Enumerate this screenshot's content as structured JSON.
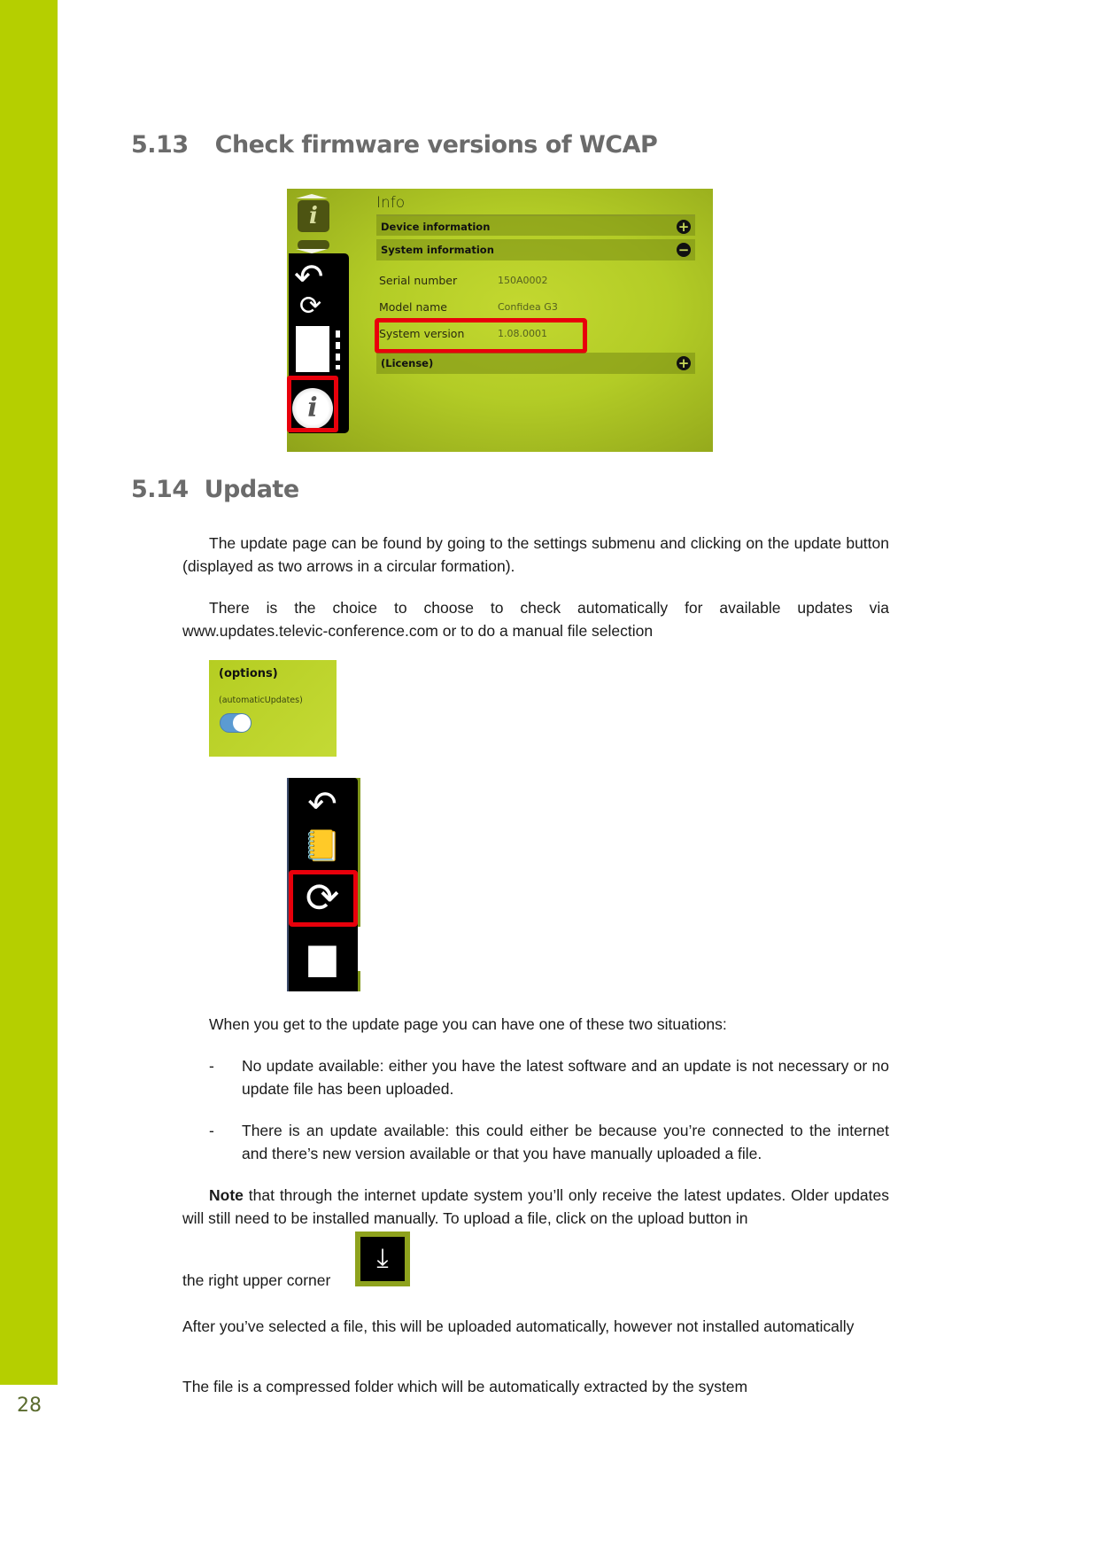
{
  "page": {
    "number": "28",
    "accent_color": "#b5cf00"
  },
  "section_513": {
    "number": "5.13",
    "title": "Check firmware versions of WCAP",
    "screenshot": {
      "panel_title": "Info",
      "sections": [
        {
          "label": "Device information",
          "state": "collapsed",
          "toggle_icon": "plus"
        },
        {
          "label": "System information",
          "state": "expanded",
          "toggle_icon": "minus"
        },
        {
          "label": "(License)",
          "state": "collapsed",
          "toggle_icon": "plus"
        }
      ],
      "fields": [
        {
          "label": "Serial number",
          "value": "150A0002"
        },
        {
          "label": "Model name",
          "value": "Confidea G3"
        },
        {
          "label": "System version",
          "value": "1.08.0001",
          "highlighted": true
        }
      ],
      "sidebar_icons": [
        "info-icon",
        "back-arrow-icon",
        "refresh-icon",
        "document-icon",
        "info-circle-icon"
      ],
      "highlighted_sidebar_icon": "info-circle-icon",
      "highlight_color": "#e8000b"
    }
  },
  "section_514": {
    "number": "5.14",
    "title": "Update",
    "paragraphs": {
      "p1": "The update page can be found by going to the settings submenu and clicking on the update button (displayed as two arrows in a circular formation).",
      "p2": "There is the choice to choose to check automatically for available updates via www.updates.televic-conference.com or to do a manual file selection",
      "p3": "When you get to the update page you can have one of these two situations:",
      "p4_bold": "Note",
      "p4": " that through the internet update system you’ll only receive the latest updates. Older updates will still need to be installed manually. To upload a file, click on the upload button in",
      "p4_tail": "the right upper corner",
      "p5": "After you’ve selected a file, this will be uploaded automatically, however not installed automatically",
      "p6": "The file is a compressed folder which will be automatically extracted by the system"
    },
    "list": [
      {
        "bullet": "-",
        "text": "No update available: either you have the latest software and an update is not necessary or no update file has been uploaded."
      },
      {
        "bullet": "-",
        "text": "There is an update available: this could either be because you’re connected to the internet and there’s new version available or that you have manually uploaded a file."
      }
    ],
    "options_screenshot": {
      "title": "(options)",
      "label": "(automaticUpdates)",
      "toggle_on": true,
      "toggle_color": "#5b9bd2"
    },
    "menu_screenshot": {
      "icons": [
        "back-arrow-icon",
        "notebook-lock-icon",
        "refresh-icon",
        "devices-icon"
      ],
      "highlighted_icon": "refresh-icon"
    },
    "upload_icon": "upload-icon"
  }
}
